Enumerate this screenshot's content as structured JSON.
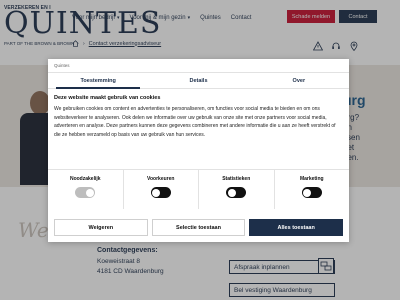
{
  "header": {
    "logo_top": "VERZEKEREN EN I",
    "logo_main": "QUINTES",
    "logo_sub": "PART OF THE BROWN & BROWN",
    "nav": [
      "Voor mijn bedrijf",
      "Voor mij & mijn gezin",
      "Quintes",
      "Contact"
    ],
    "schade_label": "Schade melden",
    "contact_label": "Contact"
  },
  "breadcrumb": {
    "separator": "›",
    "current": "Contact verzekeringsadviseur"
  },
  "hero": {
    "heading": "urg",
    "lines": [
      "urg?",
      "en",
      "ssen",
      "het",
      "nen."
    ]
  },
  "welcome": "We",
  "contact": {
    "title": "Contactgegevens:",
    "street": "Koeweistraat 8",
    "city": "4181 CD Waardenburg"
  },
  "actions": {
    "appointment": "Afspraak inplannen",
    "call": "Bel vestiging Waardenburg"
  },
  "cookie": {
    "brand": "Quintes",
    "tabs": [
      "Toestemming",
      "Details",
      "Over"
    ],
    "title": "Deze website maakt gebruik van cookies",
    "text": "We gebruiken cookies om content en advertenties te personaliseren, om functies voor social media te bieden en om ons websiteverkeer te analyseren. Ook delen we informatie over uw gebruik van onze site met onze partners voor social media, adverteren en analyse. Deze partners kunnen deze gegevens combineren met andere informatie die u aan ze heeft verstrekt of die ze hebben verzameld op basis van uw gebruik van hun services.",
    "toggles": [
      {
        "label": "Noodzakelijk",
        "state": "on"
      },
      {
        "label": "Voorkeuren",
        "state": "off"
      },
      {
        "label": "Statistieken",
        "state": "off"
      },
      {
        "label": "Marketing",
        "state": "off"
      }
    ],
    "buttons": {
      "deny": "Weigeren",
      "selection": "Selectie toestaan",
      "allow_all": "Alles toestaan"
    }
  },
  "colors": {
    "brand_navy": "#1d2f4a",
    "danger_red": "#c8102e",
    "hero_bg": "#ece6e0"
  }
}
